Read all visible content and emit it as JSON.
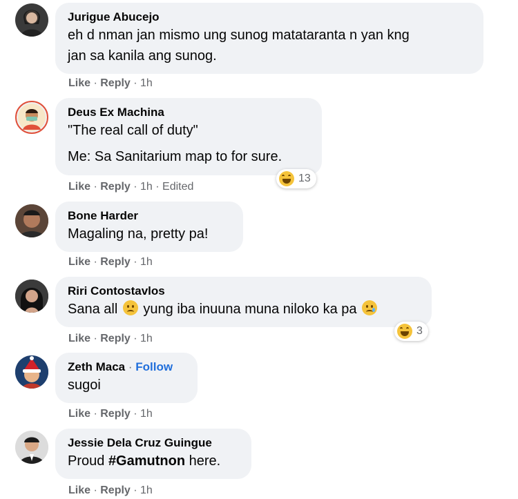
{
  "comments": [
    {
      "author": "Jurigue Abucejo",
      "lines": [
        "eh d nman jan mismo ung sunog matataranta n yan kng",
        "jan sa kanila ang sunog."
      ],
      "like": "Like",
      "reply": "Reply",
      "time": "1h"
    },
    {
      "author": "Deus Ex Machina",
      "line1": "\"The real call of duty\"",
      "line2": "Me: Sa Sanitarium map to for sure.",
      "like": "Like",
      "reply": "Reply",
      "time": "1h",
      "edited": "Edited",
      "reaction_count": "13"
    },
    {
      "author": "Bone Harder",
      "text": "Magaling na, pretty pa!",
      "like": "Like",
      "reply": "Reply",
      "time": "1h"
    },
    {
      "author": "Riri Contostavlos",
      "text_a": "Sana all",
      "text_b": "yung iba inuuna muna niloko ka pa",
      "like": "Like",
      "reply": "Reply",
      "time": "1h",
      "reaction_count": "3"
    },
    {
      "author": "Zeth Maca",
      "follow": "Follow",
      "text": "sugoi",
      "like": "Like",
      "reply": "Reply",
      "time": "1h"
    },
    {
      "author": "Jessie Dela Cruz Guingue",
      "text_a": "Proud",
      "hashtag": "#Gamutnon",
      "text_b": "here.",
      "like": "Like",
      "reply": "Reply",
      "time": "1h"
    }
  ],
  "colors": {
    "bubble": "#f0f2f5",
    "meta": "#65676b",
    "follow": "#216fdb",
    "haha": "#f5c33b"
  },
  "icons": [
    "haha-reaction-icon",
    "sad-face-emoji-icon",
    "crying-face-emoji-icon"
  ]
}
